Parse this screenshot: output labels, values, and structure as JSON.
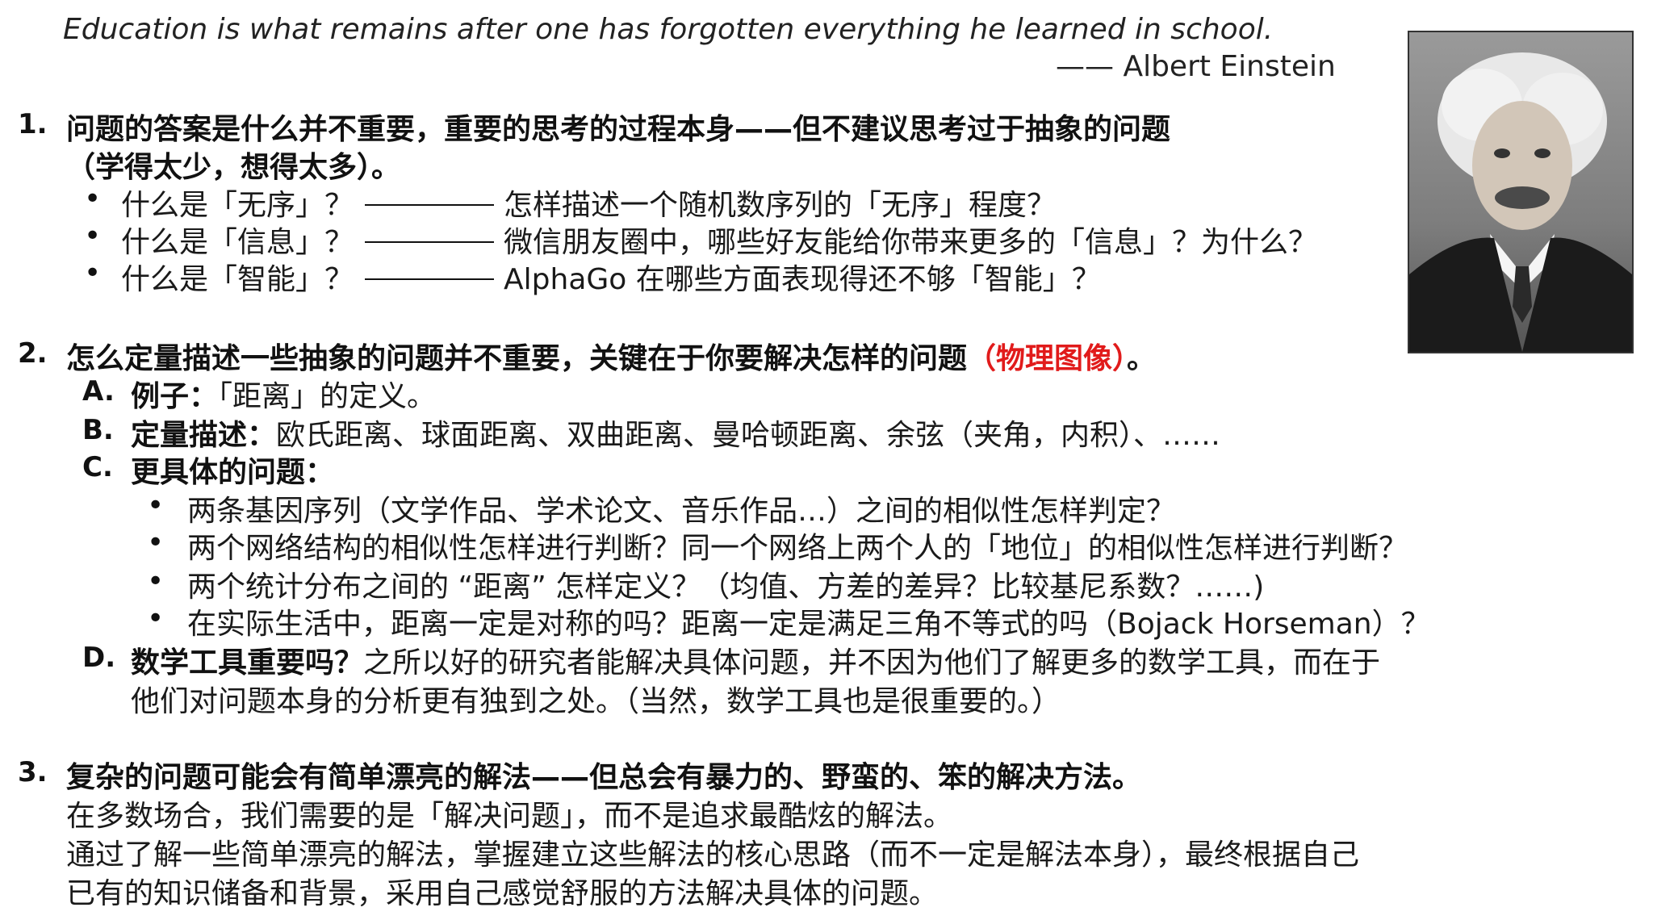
{
  "quote": {
    "text": "Education is what remains after one has forgotten everything he learned in school.",
    "attribution": "—— Albert Einstein"
  },
  "portrait": {
    "icon": "einstein-portrait"
  },
  "section1": {
    "number": "1.",
    "title_line1": "问题的答案是什么并不重要，重要的思考的过程本身——但不建议思考过于抽象的问题",
    "title_line2": "（学得太少，想得太多）。",
    "items": [
      {
        "q": "什么是「无序」？",
        "a": "怎样描述一个随机数序列的「无序」程度？"
      },
      {
        "q": "什么是「信息」？",
        "a": "微信朋友圈中，哪些好友能给你带来更多的「信息」？为什么？"
      },
      {
        "q": "什么是「智能」？",
        "a": "AlphaGo 在哪些方面表现得还不够「智能」？"
      }
    ]
  },
  "section2": {
    "number": "2.",
    "title": "怎么定量描述一些抽象的问题并不重要，关键在于你要解决怎样的问题",
    "title_red": "（物理图像）",
    "title_end": "。",
    "A": {
      "label": "A.",
      "bold": "例子：",
      "text": "「距离」的定义。"
    },
    "B": {
      "label": "B.",
      "bold": "定量描述：",
      "text": "欧氏距离、球面距离、双曲距离、曼哈顿距离、余弦（夹角，内积）、……"
    },
    "C": {
      "label": "C.",
      "bold": "更具体的问题：",
      "items": [
        "两条基因序列（文学作品、学术论文、音乐作品…）之间的相似性怎样判定？",
        "两个网络结构的相似性怎样进行判断？同一个网络上两个人的「地位」的相似性怎样进行判断？",
        "两个统计分布之间的 “距离” 怎样定义？（均值、方差的差异？比较基尼系数？……)",
        "在实际生活中，距离一定是对称的吗？距离一定是满足三角不等式的吗（Bojack Horseman）？"
      ]
    },
    "D": {
      "label": "D.",
      "bold": "数学工具重要吗？",
      "text_line1": "之所以好的研究者能解决具体问题，并不因为他们了解更多的数学工具，而在于",
      "text_line2": "他们对问题本身的分析更有独到之处。（当然，数学工具也是很重要的。）"
    }
  },
  "section3": {
    "number": "3.",
    "title": "复杂的问题可能会有简单漂亮的解法——但总会有暴力的、野蛮的、笨的解决方法。",
    "line1": "在多数场合，我们需要的是「解决问题」，而不是追求最酷炫的解法。",
    "line2": "通过了解一些简单漂亮的解法，掌握建立这些解法的核心思路（而不一定是解法本身），最终根据自己",
    "line3": "已有的知识储备和背景，采用自己感觉舒服的方法解决具体的问题。"
  }
}
